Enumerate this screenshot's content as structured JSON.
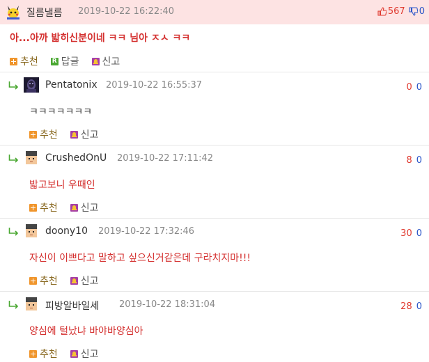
{
  "post": {
    "author": "질름낼름",
    "date": "2019-10-22 16:22:40",
    "upvotes": "567",
    "downvotes": "0",
    "text": "아...아까 밟히신분이네 ㅋㅋ 님아 ㅈㅅ ㅋㅋ",
    "actions": {
      "recommend": "추천",
      "reply": "답글",
      "report": "신고"
    }
  },
  "replies": [
    {
      "author": "Pentatonix",
      "date": "2019-10-22 16:55:37",
      "up": "0",
      "down": "0",
      "text": "ㅋㅋㅋㅋㅋㅋㅋ",
      "avatar": "dark"
    },
    {
      "author": "CrushedOnU",
      "date": "2019-10-22 17:11:42",
      "up": "8",
      "down": "0",
      "text": "밟고보니 우때인",
      "avatar": "pixel"
    },
    {
      "author": "doony10",
      "date": "2019-10-22 17:32:46",
      "up": "30",
      "down": "0",
      "text": "자신이 이쁘다고 말하고 싶으신거같은데 구라치지마!!!",
      "avatar": "pixel"
    },
    {
      "author": "피방알바일세",
      "date": "2019-10-22 18:31:04",
      "up": "28",
      "down": "0",
      "text": "양심에 털났냐 바야바양심아",
      "avatar": "pixel"
    }
  ],
  "reply_actions": {
    "recommend": "추천",
    "report": "신고"
  },
  "colors": {
    "accent_red": "#d4302f",
    "down_blue": "#2a55c8",
    "header_bg": "#fde3e3"
  }
}
